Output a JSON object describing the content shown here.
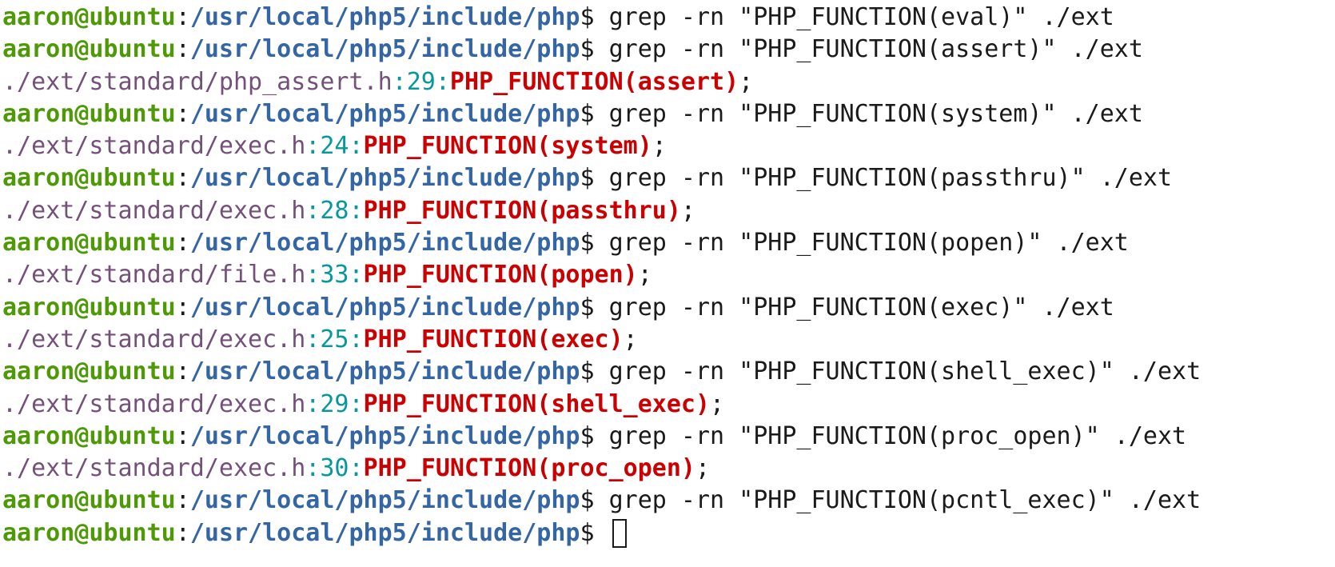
{
  "prompt": {
    "user": "aaron@ubuntu",
    "colon": ":",
    "path": "/usr/local/php5/include/php",
    "symbol": "$ "
  },
  "entries": [
    {
      "command": "grep -rn \"PHP_FUNCTION(eval)\" ./ext",
      "result": null
    },
    {
      "command": "grep -rn \"PHP_FUNCTION(assert)\" ./ext",
      "result": {
        "file": "./ext/standard/php_assert.h",
        "line": "29",
        "match": "PHP_FUNCTION(assert)",
        "suffix": ";"
      }
    },
    {
      "command": "grep -rn \"PHP_FUNCTION(system)\" ./ext",
      "result": {
        "file": "./ext/standard/exec.h",
        "line": "24",
        "match": "PHP_FUNCTION(system)",
        "suffix": ";"
      }
    },
    {
      "command": "grep -rn \"PHP_FUNCTION(passthru)\" ./ext",
      "result": {
        "file": "./ext/standard/exec.h",
        "line": "28",
        "match": "PHP_FUNCTION(passthru)",
        "suffix": ";"
      }
    },
    {
      "command": "grep -rn \"PHP_FUNCTION(popen)\" ./ext",
      "result": {
        "file": "./ext/standard/file.h",
        "line": "33",
        "match": "PHP_FUNCTION(popen)",
        "suffix": ";"
      }
    },
    {
      "command": "grep -rn \"PHP_FUNCTION(exec)\" ./ext",
      "result": {
        "file": "./ext/standard/exec.h",
        "line": "25",
        "match": "PHP_FUNCTION(exec)",
        "suffix": ";"
      }
    },
    {
      "command": "grep -rn \"PHP_FUNCTION(shell_exec)\" ./ext",
      "result": {
        "file": "./ext/standard/exec.h",
        "line": "29",
        "match": "PHP_FUNCTION(shell_exec)",
        "suffix": ";"
      }
    },
    {
      "command": "grep -rn \"PHP_FUNCTION(proc_open)\" ./ext",
      "result": {
        "file": "./ext/standard/exec.h",
        "line": "30",
        "match": "PHP_FUNCTION(proc_open)",
        "suffix": ";"
      }
    },
    {
      "command": "grep -rn \"PHP_FUNCTION(pcntl_exec)\" ./ext",
      "result": null
    }
  ],
  "current_input": "",
  "colors": {
    "user": "#4e9a06",
    "path": "#3465a4",
    "file": "#75507b",
    "line_number": "#06989a",
    "match": "#cc0000",
    "text": "#1a1a1a",
    "background": "#ffffff"
  }
}
